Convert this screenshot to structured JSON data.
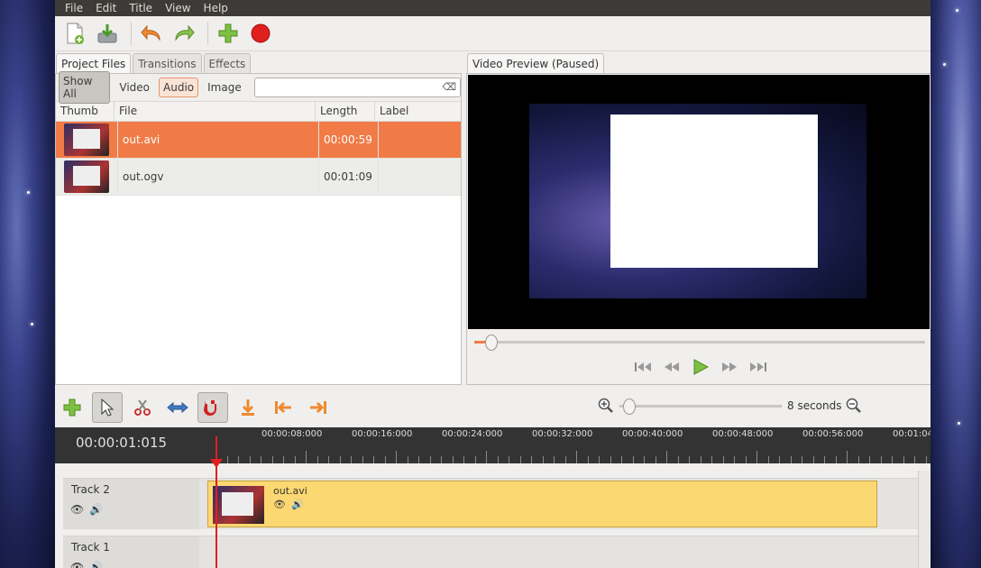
{
  "menu": [
    "File",
    "Edit",
    "Title",
    "View",
    "Help"
  ],
  "left_tabs": [
    "Project Files",
    "Transitions",
    "Effects"
  ],
  "filters": {
    "show_all": "Show All",
    "video": "Video",
    "audio": "Audio",
    "image": "Image"
  },
  "search": {
    "value": ""
  },
  "columns": [
    "Thumb",
    "File",
    "Length",
    "Label"
  ],
  "files": [
    {
      "file": "out.avi",
      "length": "00:00:59",
      "label": ""
    },
    {
      "file": "out.ogv",
      "length": "00:01:09",
      "label": ""
    }
  ],
  "preview_tab": "Video Preview (Paused)",
  "zoom_label": "8 seconds",
  "timecode": "00:00:01:015",
  "ruler": [
    "00:00:08:000",
    "00:00:16:000",
    "00:00:24:000",
    "00:00:32:000",
    "00:00:40:000",
    "00:00:48:000",
    "00:00:56:000",
    "00:01:04"
  ],
  "tracks": [
    {
      "name": "Track 2",
      "clip": "out.avi"
    },
    {
      "name": "Track 1"
    }
  ],
  "colors": {
    "accent": "#f07b46",
    "clip": "#fcd872",
    "playhead": "#e02020"
  }
}
